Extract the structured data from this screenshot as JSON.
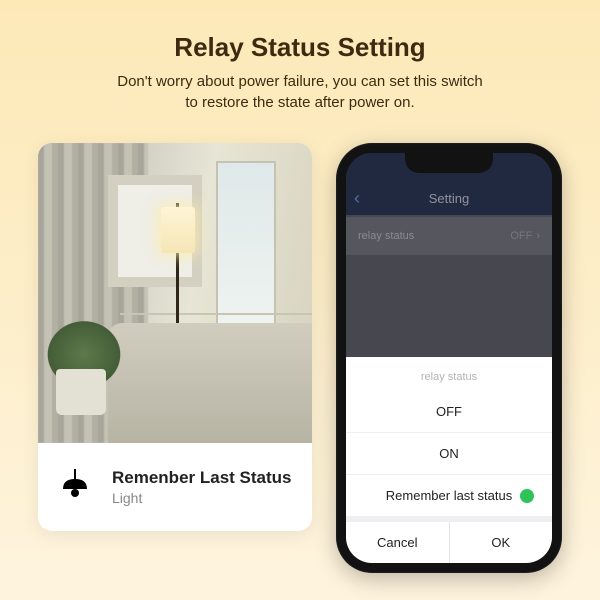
{
  "header": {
    "title": "Relay Status Setting",
    "subtitle_l1": "Don't worry about power failure, you can set this switch",
    "subtitle_l2": "to restore the state after power on."
  },
  "card": {
    "title": "Remenber Last Status",
    "subtitle": "Light",
    "icon": "pendant-lamp-icon"
  },
  "phone": {
    "nav": {
      "back_glyph": "‹",
      "title": "Setting"
    },
    "setting_row": {
      "label": "relay status",
      "value": "OFF",
      "chevron": "›"
    },
    "sheet": {
      "title": "relay status",
      "options": [
        {
          "label": "OFF",
          "selected": false
        },
        {
          "label": "ON",
          "selected": false
        },
        {
          "label": "Remember last status",
          "selected": true
        }
      ],
      "cancel": "Cancel",
      "ok": "OK"
    }
  }
}
